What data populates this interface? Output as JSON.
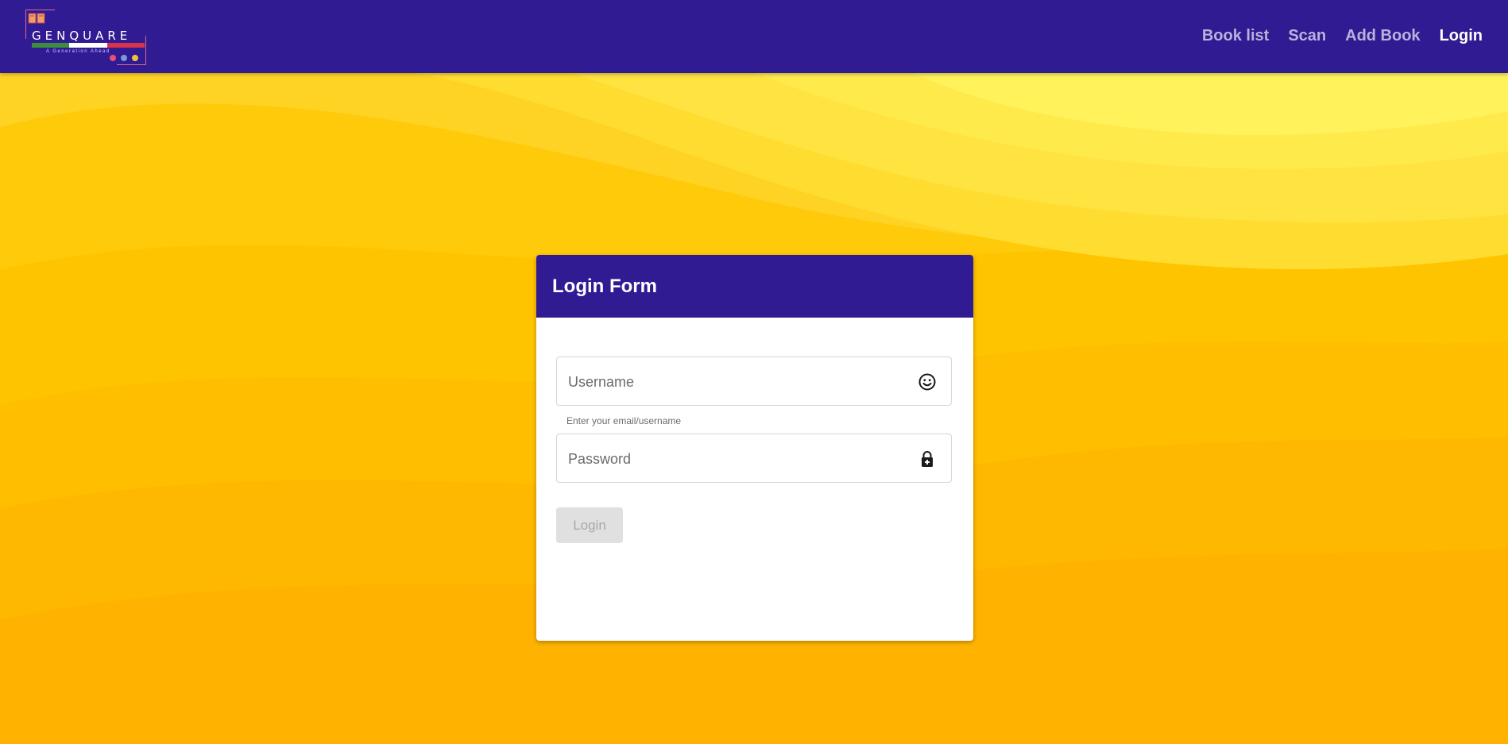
{
  "brand": {
    "name": "GENQUARE",
    "tagline": "A Generation Ahead"
  },
  "nav": {
    "items": [
      {
        "label": "Book list",
        "active": false
      },
      {
        "label": "Scan",
        "active": false
      },
      {
        "label": "Add Book",
        "active": false
      },
      {
        "label": "Login",
        "active": true
      }
    ]
  },
  "login_form": {
    "title": "Login Form",
    "username": {
      "placeholder": "Username",
      "value": "",
      "hint": "Enter your email/username",
      "icon": "smiley-face-icon"
    },
    "password": {
      "placeholder": "Password",
      "value": "",
      "icon": "lock-plus-icon"
    },
    "submit_label": "Login",
    "submit_disabled": true
  },
  "colors": {
    "navbar": "#311b92",
    "background_yellow": "#ffc107",
    "button_disabled": "#e0e0e0"
  }
}
